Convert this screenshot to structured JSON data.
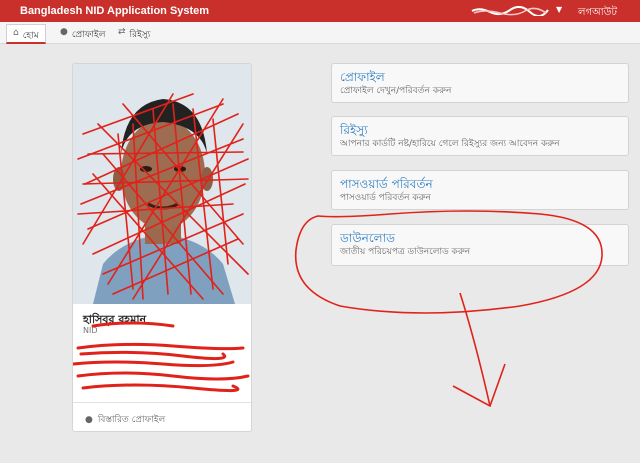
{
  "app": {
    "title": "Bangladesh NID Application System"
  },
  "header": {
    "user_name": "",
    "logout_label": "লগআউট"
  },
  "tabs": [
    {
      "label": "হোম",
      "icon": "home-icon",
      "active": true
    },
    {
      "label": "প্রোফাইল",
      "icon": "user-icon",
      "active": false
    },
    {
      "label": "রিইস্যু",
      "icon": "refresh-icon",
      "active": false
    }
  ],
  "profile": {
    "name": "হাসিবুর রহমান",
    "nid_label": "NID",
    "detail_label": "বিস্তারিত প্রোফাইল"
  },
  "menu": [
    {
      "title": "প্রোফাইল",
      "desc": "প্রোফাইল দেখুন/পরিবর্তন করুন"
    },
    {
      "title": "রিইস্যু",
      "desc": "আপনার কার্ডটি নষ্ট/হারিয়ে গেলে রিইস্যুর জন্য আবেদন করুন"
    },
    {
      "title": "পাসওয়ার্ড পরিবর্তন",
      "desc": "পাসওয়ার্ড পরিবর্তন করুন"
    },
    {
      "title": "ডাউনলোড",
      "desc": "জাতীয় পরিচয়পত্র ডাউনলোড করুন"
    }
  ],
  "colors": {
    "brand_red": "#c9302c",
    "link_blue": "#2a7bbf",
    "scribble_red": "#e0221a"
  }
}
